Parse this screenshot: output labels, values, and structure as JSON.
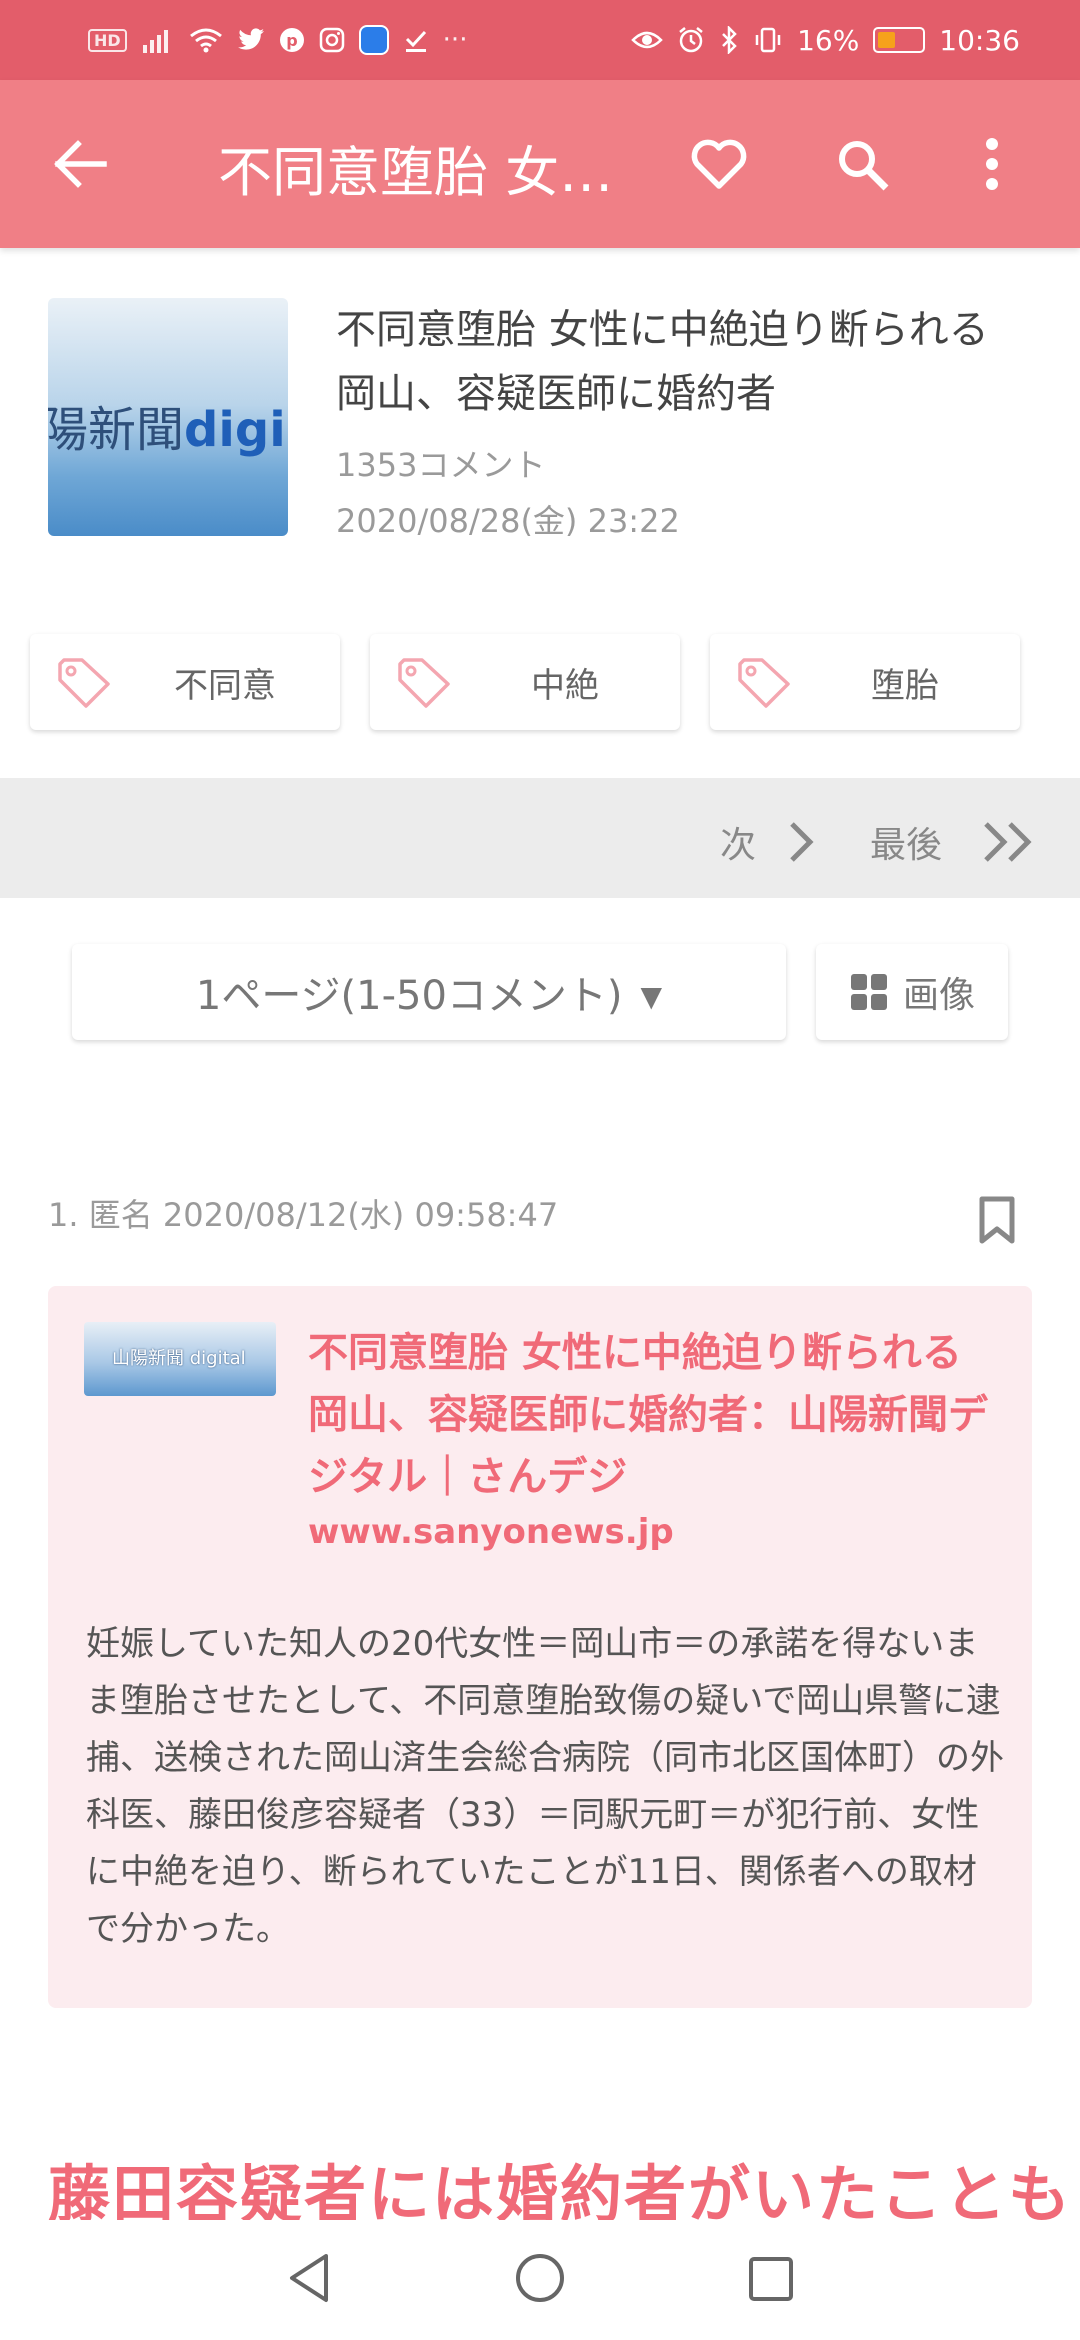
{
  "status_bar": {
    "hd": "HD",
    "left_extra": "···",
    "battery_percent": "16%",
    "battery_level": 0.16,
    "time": "10:36"
  },
  "app_bar": {
    "title": "不同意堕胎 女性に中絶迫り断られる　岡山、容疑医師に婚約者"
  },
  "article": {
    "thumb_text": "陽新聞",
    "thumb_text_b": "digi",
    "headline": "不同意堕胎 女性に中絶迫り断られる　岡山、容疑医師に婚約者",
    "comments": "1353コメント",
    "date": "2020/08/28(金) 23:22"
  },
  "tags": [
    {
      "label": "不同意"
    },
    {
      "label": "中絶"
    },
    {
      "label": "堕胎"
    }
  ],
  "pager": {
    "next": "次",
    "last": "最後"
  },
  "page_select": {
    "value": "1ページ(1-50コメント)"
  },
  "image_button": {
    "label": "画像"
  },
  "comment": {
    "meta": "1. 匿名 2020/08/12(水) 09:58:47",
    "link_thumb_text": "山陽新聞 digital",
    "link_title": "不同意堕胎 女性に中絶迫り断られる　岡山、容疑医師に婚約者：山陽新聞デジタル｜さんデジ",
    "link_domain": "www.sanyonews.jp",
    "body": "妊娠していた知人の20代女性＝岡山市＝の承諾を得ないまま堕胎させたとして、不同意堕胎致傷の疑いで岡山県警に逮捕、送検された岡山済生会総合病院（同市北区国体町）の外科医、藤田俊彦容疑者（33）＝同駅元町＝が犯行前、女性に中絶を迫り、断られていたことが11日、関係者への取材で分かった。",
    "heading": "藤田容疑者には婚約者がいたことも"
  },
  "colors": {
    "status_bar": "#e35d6a",
    "app_bar": "#f07f86",
    "accent": "#f06a78",
    "card_bg": "#fcecef"
  }
}
